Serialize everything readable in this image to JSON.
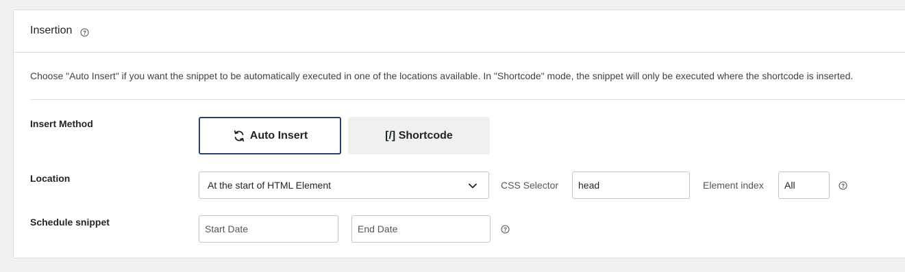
{
  "panel": {
    "title": "Insertion",
    "description": "Choose \"Auto Insert\" if you want the snippet to be automatically executed in one of the locations available. In \"Shortcode\" mode, the snippet will only be executed where the shortcode is inserted."
  },
  "insert_method": {
    "label": "Insert Method",
    "auto_insert_label": "Auto Insert",
    "shortcode_label": "[/] Shortcode",
    "selected": "Auto Insert"
  },
  "location": {
    "label": "Location",
    "selected_value": "At the start of HTML Element",
    "css_selector_label": "CSS Selector",
    "css_selector_value": "head",
    "element_index_label": "Element index",
    "element_index_value": "All"
  },
  "schedule": {
    "label": "Schedule snippet",
    "start_placeholder": "Start Date",
    "end_placeholder": "End Date"
  },
  "icons": {
    "help": "question-circle-icon",
    "auto_insert": "sync-arrows-icon",
    "dropdown": "chevron-down-icon"
  },
  "colors": {
    "selected_border": "#2c3e6e",
    "unselected_bg": "#f0f0f1"
  }
}
